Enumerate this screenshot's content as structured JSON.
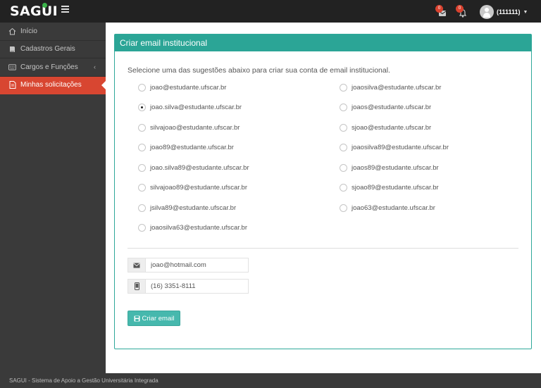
{
  "app": {
    "logo": "SAGUI"
  },
  "header": {
    "badge_messages": "0",
    "badge_notifications": "0",
    "user_label": "(111111)"
  },
  "sidebar": {
    "items": [
      {
        "label": "Início",
        "icon": "home-icon"
      },
      {
        "label": "Cadastros Gerais",
        "icon": "book-icon"
      },
      {
        "label": "Cargos e Funções",
        "icon": "keyboard-icon"
      },
      {
        "label": "Minhas solicitações",
        "icon": "document-icon"
      }
    ]
  },
  "main": {
    "panel_title": "Criar email institucional",
    "intro": "Selecione uma das sugestões abaixo para criar sua conta de email institucional.",
    "options_left": [
      "joao@estudante.ufscar.br",
      "joao.silva@estudante.ufscar.br",
      "silvajoao@estudante.ufscar.br",
      "joao89@estudante.ufscar.br",
      "joao.silva89@estudante.ufscar.br",
      "silvajoao89@estudante.ufscar.br",
      "jsilva89@estudante.ufscar.br",
      "joaosilva63@estudante.ufscar.br"
    ],
    "options_right": [
      "joaosilva@estudante.ufscar.br",
      "joaos@estudante.ufscar.br",
      "sjoao@estudante.ufscar.br",
      "joaosilva89@estudante.ufscar.br",
      "joaos89@estudante.ufscar.br",
      "sjoao89@estudante.ufscar.br",
      "joao63@estudante.ufscar.br"
    ],
    "selected": "joao.silva@estudante.ufscar.br",
    "email_value": "joao@hotmail.com",
    "phone_value": "(16) 3351-8111",
    "create_button": "Criar email"
  },
  "footer": {
    "text": "SAGUI - Sistema de Apoio a Gestão Universitária Integrada"
  },
  "colors": {
    "accent": "#2ba596",
    "active_nav": "#d84631",
    "topbar": "#222222",
    "sidebar": "#3a3a3a"
  }
}
